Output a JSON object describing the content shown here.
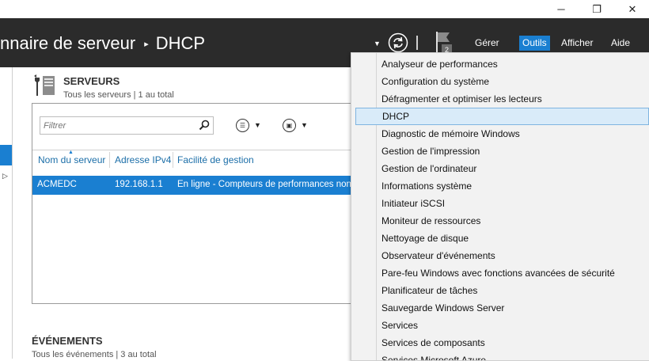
{
  "window": {
    "minimize": "─",
    "restore": "❐",
    "close": "✕"
  },
  "header": {
    "breadcrumb_parent": "nnaire de serveur",
    "breadcrumb_sep": "▸",
    "breadcrumb_current": "DHCP",
    "flag_badge": "2",
    "menus": [
      "Gérer",
      "Outils",
      "Afficher",
      "Aide"
    ],
    "active_menu": "Outils"
  },
  "servers": {
    "title": "SERVEURS",
    "subtitle": "Tous les serveurs | 1 au total",
    "filter_placeholder": "Filtrer",
    "columns": [
      "Nom du serveur",
      "Adresse IPv4",
      "Facilité de gestion"
    ],
    "rows": [
      {
        "name": "ACMEDC",
        "ip": "192.168.1.1",
        "manageability": "En ligne - Compteurs de performances non démarrés"
      }
    ]
  },
  "events": {
    "title": "ÉVÉNEMENTS",
    "subtitle": "Tous les événements | 3 au total"
  },
  "tools_menu": {
    "items": [
      "Analyseur de performances",
      "Configuration du système",
      "Défragmenter et optimiser les lecteurs",
      "DHCP",
      "Diagnostic de mémoire Windows",
      "Gestion de l'impression",
      "Gestion de l'ordinateur",
      "Informations système",
      "Initiateur iSCSI",
      "Moniteur de ressources",
      "Nettoyage de disque",
      "Observateur d'événements",
      "Pare-feu Windows avec fonctions avancées de sécurité",
      "Planificateur de tâches",
      "Sauvegarde Windows Server",
      "Services",
      "Services de composants",
      "Services Microsoft Azure"
    ],
    "highlighted": "DHCP"
  },
  "colors": {
    "header_bg": "#2b2b2b",
    "accent": "#1a7fd1",
    "highlight_bg": "#d9ebf9"
  }
}
